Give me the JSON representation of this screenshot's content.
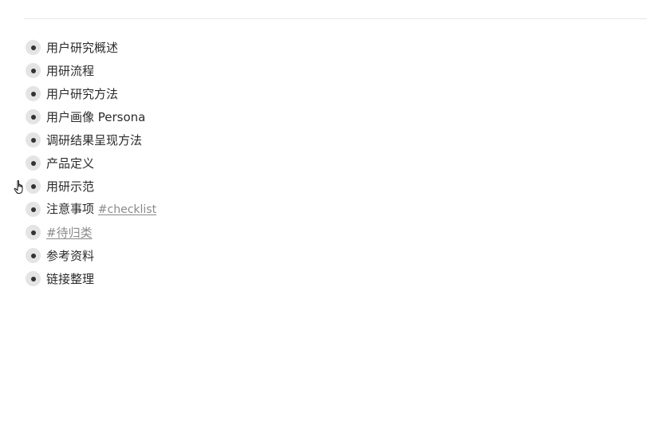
{
  "outline": {
    "items": [
      {
        "label": "用户研究概述"
      },
      {
        "label": "用研流程"
      },
      {
        "label": "用户研究方法"
      },
      {
        "label": "用户画像 Persona"
      },
      {
        "label": "调研结果呈现方法"
      },
      {
        "label": "产品定义"
      },
      {
        "label": "用研示范"
      },
      {
        "label": "注意事项",
        "tag": "#checklist"
      },
      {
        "label": "",
        "tag": "#待归类"
      },
      {
        "label": "参考资料"
      },
      {
        "label": "链接整理"
      }
    ]
  },
  "icons": {
    "bullet": "bullet-dot-icon",
    "cursor": "hand-pointer-icon"
  }
}
